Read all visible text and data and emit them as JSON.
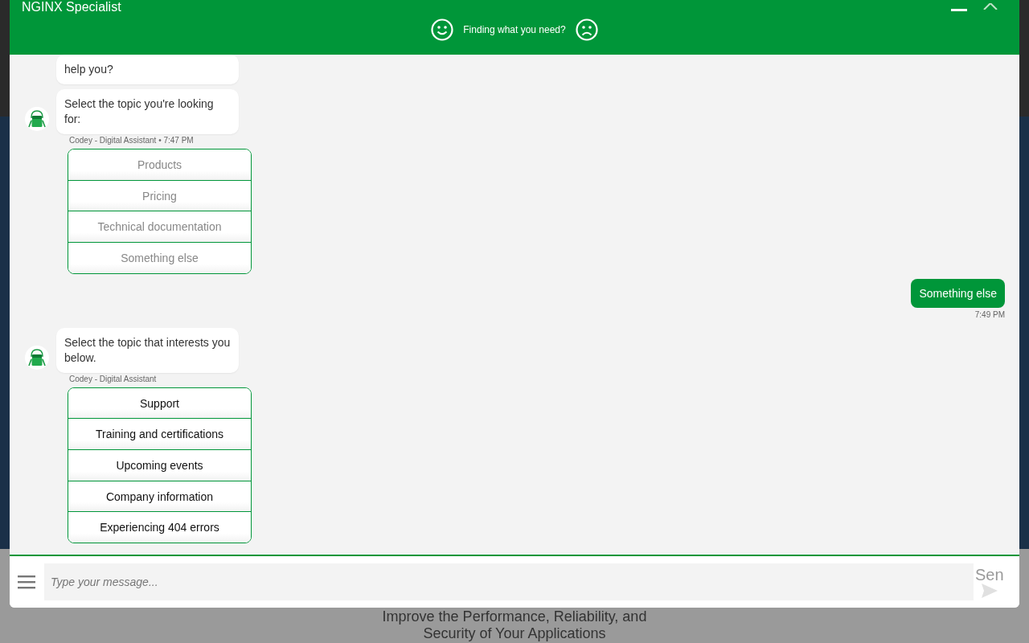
{
  "window": {
    "title": "NGINX Specialist"
  },
  "feedback": {
    "prompt": "Finding what you need?"
  },
  "messages": [
    {
      "kind": "bot",
      "avatar": false,
      "text": "help you?"
    },
    {
      "kind": "bot",
      "avatar": true,
      "text": "Select the topic you're looking for:",
      "meta": "Codey - Digital Assistant • 7:47 PM",
      "answered": true,
      "options": [
        "Products",
        "Pricing",
        "Technical documentation",
        "Something else"
      ]
    },
    {
      "kind": "user",
      "text": "Something else",
      "meta": "7:49 PM"
    },
    {
      "kind": "bot",
      "avatar": true,
      "text": "Select the topic that interests you below.",
      "meta": "Codey - Digital Assistant",
      "answered": false,
      "options": [
        "Support",
        "Training and certifications",
        "Upcoming events",
        "Company information",
        "Experiencing 404 errors"
      ]
    }
  ],
  "composer": {
    "placeholder": "Type your message...",
    "send_label": "Sen"
  },
  "background_page": {
    "headline_lines": [
      "Improve the Performance, Reliability, and",
      "Security of Your Applications"
    ]
  }
}
